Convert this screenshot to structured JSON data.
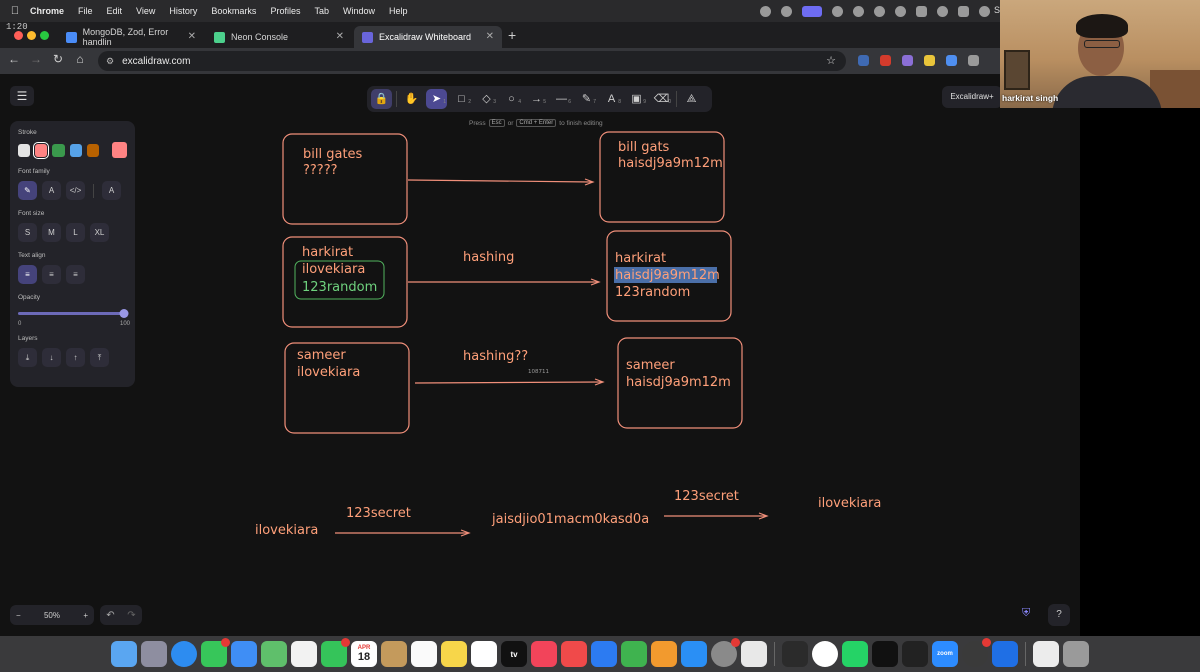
{
  "menubar": {
    "app": "Chrome",
    "items": [
      "File",
      "Edit",
      "View",
      "History",
      "Bookmarks",
      "Profiles",
      "Tab",
      "Window",
      "Help"
    ],
    "clock": "Sa"
  },
  "timer": "1:20",
  "tabs": [
    {
      "title": "MongoDB, Zod, Error handlin",
      "favicon_color": "#4a8cf7"
    },
    {
      "title": "Neon Console",
      "favicon_color": "#4cd08c"
    },
    {
      "title": "Excalidraw Whiteboard",
      "favicon_color": "#6965db"
    }
  ],
  "address": {
    "url": "excalidraw.com"
  },
  "excalidraw": {
    "hint": {
      "pre": "Press",
      "key1": "Esc",
      "mid": "or",
      "key2": "Cmd + Enter",
      "post": "to finish editing"
    },
    "library_label": "Excalidraw+",
    "zoom": "50%",
    "panel": {
      "stroke_label": "Stroke",
      "stroke_colors": [
        "#e3e3e3",
        "#ff8383",
        "#3a994c",
        "#56a2e8",
        "#b76100"
      ],
      "current_stroke": "#ff8383",
      "font_family_label": "Font family",
      "font_size_label": "Font size",
      "font_sizes": [
        "S",
        "M",
        "L",
        "XL"
      ],
      "text_align_label": "Text align",
      "opacity_label": "Opacity",
      "opacity_value": 100,
      "opacity_min": "0",
      "opacity_max": "100",
      "layers_label": "Layers"
    }
  },
  "canvas": {
    "box1": {
      "lines": [
        "bill gates",
        "?????"
      ]
    },
    "box2": {
      "lines": [
        "bill gats",
        "haisdj9a9m12m"
      ]
    },
    "box3": {
      "lines": [
        "harkirat",
        "ilovekiara",
        "123random"
      ]
    },
    "box4": {
      "lines": [
        "harkirat",
        "haisdj9a9m12m",
        "123random"
      ]
    },
    "box5": {
      "lines": [
        "sameer",
        "ilovekiara"
      ]
    },
    "box6": {
      "lines": [
        "sameer",
        "haisdj9a9m12m"
      ]
    },
    "label_hashing": "hashing",
    "label_hashing2": "hashing??",
    "small_number": "108711",
    "bottom": {
      "left": "ilovekiara",
      "key1": "123secret",
      "middle": "jaisdjio01macm0kasd0a",
      "key2": "123secret",
      "right": "ilovekiara"
    },
    "colors": {
      "ink": "#ffa07a",
      "box_stroke": "#f08f7a",
      "green": "#52b45f",
      "selection": "#4b6fa8"
    }
  },
  "webcam": {
    "name": "harkirat singh"
  },
  "dock": {
    "calendar_month": "APR",
    "calendar_day": "18",
    "tv_label": "tv",
    "zoom_label": "zoom"
  }
}
